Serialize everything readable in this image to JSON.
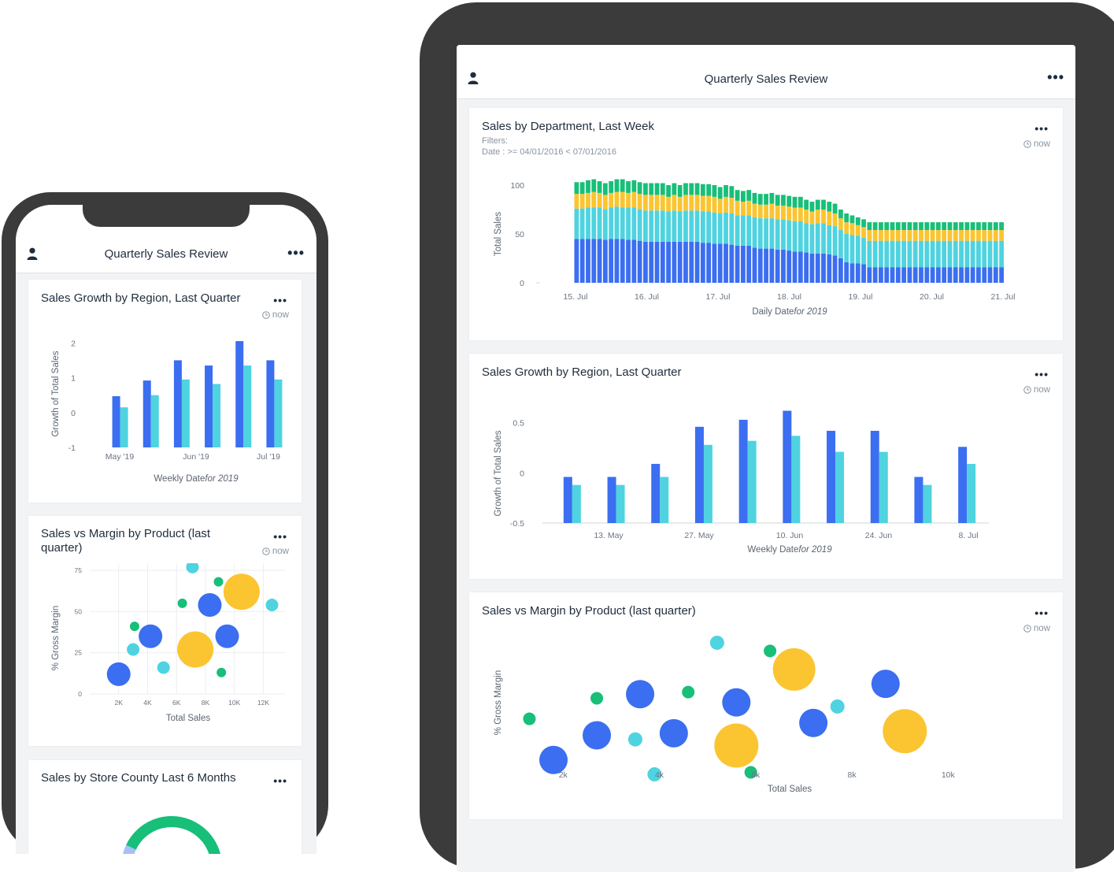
{
  "colors": {
    "blue": "#3b6ef0",
    "cyan": "#4fd3e0",
    "yellow": "#fbc531",
    "green": "#17bf79"
  },
  "phone": {
    "header": {
      "title": "Quarterly Sales Review",
      "user_icon": "user-icon",
      "menu_icon": "more-icon"
    },
    "cards": {
      "growth": {
        "title": "Sales Growth by Region, Last Quarter",
        "time": "now"
      },
      "margin": {
        "title_line1": "Sales vs Margin by Product (last",
        "title_line2": "quarter)",
        "time": "now"
      },
      "county": {
        "title": "Sales by Store County Last 6 Months"
      }
    }
  },
  "tablet": {
    "header": {
      "title": "Quarterly Sales Review",
      "user_icon": "user-icon",
      "menu_icon": "more-icon"
    },
    "cards": {
      "dept": {
        "title": "Sales by Department, Last Week",
        "filters_label": "Filters:",
        "filters_value": "Date : >= 04/01/2016 < 07/01/2016",
        "time": "now"
      },
      "growth": {
        "title": "Sales Growth by Region, Last Quarter",
        "time": "now"
      },
      "margin": {
        "title": "Sales vs Margin by Product (last quarter)",
        "time": "now"
      }
    }
  },
  "chart_data": [
    {
      "id": "tablet-dept",
      "type": "bar",
      "stacked": true,
      "ylabel": "Total Sales",
      "xlabel": "Daily Date",
      "xlabel_suffix": "for 2019",
      "ylim": [
        0,
        100
      ],
      "yticks": [
        0,
        50,
        100
      ],
      "xticks": [
        "15. Jul",
        "16. Jul",
        "17. Jul",
        "18. Jul",
        "19. Jul",
        "20. Jul",
        "21. Jul"
      ],
      "series": [
        {
          "values": [
            45,
            45,
            45,
            45,
            45,
            44,
            45,
            45,
            45,
            44,
            44,
            43,
            42,
            42,
            42,
            42,
            42,
            42,
            42,
            42,
            42,
            42,
            41,
            41,
            40,
            40,
            40,
            39,
            38,
            38,
            38,
            36,
            35,
            35,
            35,
            34,
            34,
            33,
            32,
            32,
            31,
            30,
            30,
            30,
            29,
            28,
            25,
            21,
            20,
            20,
            19,
            16,
            16,
            16,
            16,
            16,
            16,
            16,
            16,
            16,
            16,
            16,
            16,
            16,
            16,
            16,
            16,
            16,
            16,
            16,
            16,
            16,
            16,
            16,
            16
          ]
        },
        {
          "values": [
            31,
            31,
            32,
            32,
            32,
            31,
            32,
            33,
            32,
            33,
            33,
            32,
            32,
            32,
            32,
            32,
            31,
            32,
            31,
            32,
            32,
            32,
            32,
            32,
            32,
            31,
            32,
            32,
            31,
            31,
            31,
            31,
            31,
            31,
            31,
            31,
            31,
            31,
            31,
            31,
            30,
            30,
            31,
            31,
            30,
            30,
            29,
            29,
            29,
            28,
            27,
            27,
            27,
            27,
            27,
            27,
            27,
            27,
            27,
            27,
            27,
            27,
            27,
            27,
            27,
            27,
            27,
            27,
            27,
            27,
            27,
            27,
            27,
            27,
            27
          ]
        },
        {
          "values": [
            15,
            15,
            15,
            16,
            15,
            15,
            15,
            15,
            16,
            15,
            16,
            16,
            16,
            16,
            16,
            16,
            15,
            16,
            15,
            16,
            16,
            16,
            16,
            16,
            16,
            15,
            16,
            16,
            15,
            14,
            15,
            14,
            14,
            14,
            15,
            14,
            14,
            14,
            14,
            14,
            14,
            13,
            14,
            14,
            14,
            13,
            12,
            12,
            12,
            11,
            11,
            11,
            11,
            11,
            11,
            11,
            11,
            11,
            11,
            11,
            11,
            11,
            11,
            11,
            11,
            11,
            11,
            11,
            11,
            11,
            11,
            11,
            11,
            11,
            11
          ]
        },
        {
          "values": [
            12,
            12,
            13,
            13,
            12,
            12,
            12,
            13,
            13,
            12,
            12,
            12,
            12,
            12,
            12,
            12,
            12,
            12,
            12,
            12,
            12,
            12,
            12,
            12,
            12,
            12,
            12,
            12,
            11,
            11,
            11,
            11,
            11,
            11,
            11,
            11,
            11,
            11,
            11,
            11,
            10,
            10,
            10,
            10,
            10,
            10,
            9,
            9,
            8,
            8,
            8,
            8,
            8,
            8,
            8,
            8,
            8,
            8,
            8,
            8,
            8,
            8,
            8,
            8,
            8,
            8,
            8,
            8,
            8,
            8,
            8,
            8,
            8,
            8,
            8
          ]
        }
      ]
    },
    {
      "id": "tablet-growth",
      "type": "bar",
      "ylabel": "Growth of Total Sales",
      "xlabel": "Weekly Date",
      "xlabel_suffix": "for 2019",
      "ylim": [
        -0.5,
        0.6
      ],
      "yticks": [
        -0.5,
        0,
        0.5
      ],
      "xticks": [
        "13. May",
        "27. May",
        "10. Jun",
        "24. Jun",
        "8. Jul"
      ],
      "series": [
        {
          "values": [
            -0.04,
            -0.04,
            0.09,
            0.46,
            0.53,
            0.62,
            0.42,
            0.42,
            -0.04,
            0.26
          ]
        },
        {
          "values": [
            -0.12,
            -0.12,
            -0.04,
            0.28,
            0.32,
            0.37,
            0.21,
            0.21,
            -0.12,
            0.09
          ]
        }
      ]
    },
    {
      "id": "tablet-margin",
      "type": "scatter",
      "xlabel": "Total Sales",
      "ylabel": "% Gross Margin",
      "xticks": [
        "2k",
        "4k",
        "6k",
        "8k",
        "10k"
      ],
      "xlim": [
        0.9,
        11.5
      ],
      "ylim": [
        0,
        90
      ],
      "points": [
        {
          "x": 1.3,
          "y": 40,
          "r": 8,
          "c": "green"
        },
        {
          "x": 1.8,
          "y": 20,
          "r": 18,
          "c": "blue"
        },
        {
          "x": 2.7,
          "y": 32,
          "r": 18,
          "c": "blue"
        },
        {
          "x": 2.7,
          "y": 50,
          "r": 8,
          "c": "green"
        },
        {
          "x": 3.5,
          "y": 30,
          "r": 9,
          "c": "cyan"
        },
        {
          "x": 3.6,
          "y": 52,
          "r": 18,
          "c": "blue"
        },
        {
          "x": 3.9,
          "y": 13,
          "r": 9,
          "c": "cyan"
        },
        {
          "x": 4.3,
          "y": 33,
          "r": 18,
          "c": "blue"
        },
        {
          "x": 4.6,
          "y": 53,
          "r": 8,
          "c": "green"
        },
        {
          "x": 5.2,
          "y": 77,
          "r": 9,
          "c": "cyan"
        },
        {
          "x": 5.6,
          "y": 48,
          "r": 18,
          "c": "blue"
        },
        {
          "x": 5.6,
          "y": 27,
          "r": 28,
          "c": "yellow"
        },
        {
          "x": 5.9,
          "y": 14,
          "r": 8,
          "c": "green"
        },
        {
          "x": 6.3,
          "y": 73,
          "r": 8,
          "c": "green"
        },
        {
          "x": 6.8,
          "y": 64,
          "r": 27,
          "c": "yellow"
        },
        {
          "x": 7.2,
          "y": 38,
          "r": 18,
          "c": "blue"
        },
        {
          "x": 7.7,
          "y": 46,
          "r": 9,
          "c": "cyan"
        },
        {
          "x": 8.7,
          "y": 57,
          "r": 18,
          "c": "blue"
        },
        {
          "x": 9.1,
          "y": 34,
          "r": 28,
          "c": "yellow"
        }
      ]
    },
    {
      "id": "phone-growth",
      "type": "bar",
      "ylabel": "Growth of Total Sales",
      "xlabel": "Weekly Date",
      "xlabel_suffix": "for 2019",
      "ylim": [
        -1,
        2.3
      ],
      "yticks": [
        -1,
        0,
        1,
        2
      ],
      "xticks": [
        "May '19",
        "Jun '19",
        "Jul '19"
      ],
      "series": [
        {
          "values": [
            0.47,
            0.92,
            1.5,
            1.35,
            2.05,
            1.5
          ]
        },
        {
          "values": [
            0.15,
            0.5,
            0.95,
            0.82,
            1.35,
            0.95
          ]
        }
      ]
    },
    {
      "id": "phone-margin",
      "type": "scatter",
      "xlabel": "Total Sales",
      "ylabel": "% Gross Margin",
      "xticks": [
        "2K",
        "4K",
        "6K",
        "8K",
        "10K",
        "12K"
      ],
      "yticks": [
        0,
        25,
        50,
        75
      ],
      "xlim": [
        0,
        13.5
      ],
      "ylim": [
        0,
        86
      ],
      "points": [
        {
          "x": 2.0,
          "y": 12,
          "r": 15,
          "c": "blue"
        },
        {
          "x": 3.1,
          "y": 41,
          "r": 6,
          "c": "green"
        },
        {
          "x": 3.0,
          "y": 27,
          "r": 8,
          "c": "cyan"
        },
        {
          "x": 4.2,
          "y": 35,
          "r": 15,
          "c": "blue"
        },
        {
          "x": 5.1,
          "y": 16,
          "r": 8,
          "c": "cyan"
        },
        {
          "x": 6.4,
          "y": 55,
          "r": 6,
          "c": "green"
        },
        {
          "x": 7.1,
          "y": 77,
          "r": 8,
          "c": "cyan"
        },
        {
          "x": 7.3,
          "y": 27,
          "r": 23,
          "c": "yellow"
        },
        {
          "x": 8.3,
          "y": 54,
          "r": 15,
          "c": "blue"
        },
        {
          "x": 8.9,
          "y": 68,
          "r": 6,
          "c": "green"
        },
        {
          "x": 9.5,
          "y": 35,
          "r": 15,
          "c": "blue"
        },
        {
          "x": 9.1,
          "y": 13,
          "r": 6,
          "c": "green"
        },
        {
          "x": 10.5,
          "y": 62,
          "r": 23,
          "c": "yellow"
        },
        {
          "x": 12.6,
          "y": 54,
          "r": 8,
          "c": "cyan"
        }
      ]
    },
    {
      "id": "phone-county",
      "type": "pie",
      "slices": [
        {
          "value": 55,
          "c": "green"
        },
        {
          "value": 20,
          "c": "blue"
        },
        {
          "value": 25,
          "c": "lightblue"
        }
      ]
    }
  ]
}
